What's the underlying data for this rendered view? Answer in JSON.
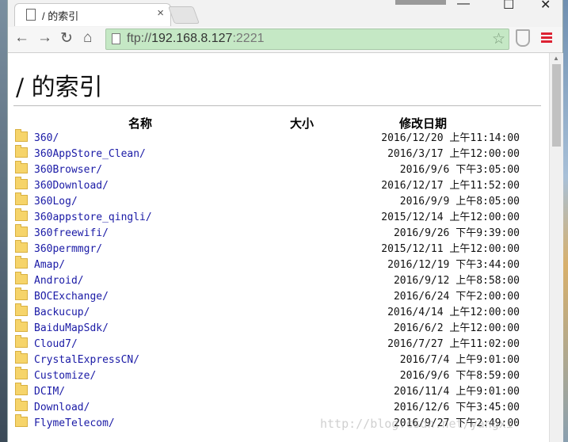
{
  "tab": {
    "title": "/ 的索引",
    "close": "×"
  },
  "nav": {
    "back": "←",
    "forward": "→",
    "reload": "↻",
    "home": "⌂"
  },
  "address": {
    "scheme": "ftp://",
    "host": "192.168.8.127",
    "port": ":2221"
  },
  "window_controls": {
    "minimize": "—",
    "maximize": "☐",
    "close": "✕"
  },
  "page": {
    "heading": "/ 的索引",
    "columns": {
      "name": "名称",
      "size": "大小",
      "date": "修改日期"
    },
    "rows": [
      {
        "name": "360/",
        "date": "2016/12/20 上午11:14:00"
      },
      {
        "name": "360AppStore_Clean/",
        "date": "2016/3/17 上午12:00:00"
      },
      {
        "name": "360Browser/",
        "date": "2016/9/6 下午3:05:00"
      },
      {
        "name": "360Download/",
        "date": "2016/12/17 上午11:52:00"
      },
      {
        "name": "360Log/",
        "date": "2016/9/9 上午8:05:00"
      },
      {
        "name": "360appstore_qingli/",
        "date": "2015/12/14 上午12:00:00"
      },
      {
        "name": "360freewifi/",
        "date": "2016/9/26 下午9:39:00"
      },
      {
        "name": "360permmgr/",
        "date": "2015/12/11 上午12:00:00"
      },
      {
        "name": "Amap/",
        "date": "2016/12/19 下午3:44:00"
      },
      {
        "name": "Android/",
        "date": "2016/9/12 上午8:58:00"
      },
      {
        "name": "BOCExchange/",
        "date": "2016/6/24 下午2:00:00"
      },
      {
        "name": "Backucup/",
        "date": "2016/4/14 上午12:00:00"
      },
      {
        "name": "BaiduMapSdk/",
        "date": "2016/6/2 上午12:00:00"
      },
      {
        "name": "Cloud7/",
        "date": "2016/7/27 上午11:02:00"
      },
      {
        "name": "CrystalExpressCN/",
        "date": "2016/7/4 上午9:01:00"
      },
      {
        "name": "Customize/",
        "date": "2016/9/6 下午8:59:00"
      },
      {
        "name": "DCIM/",
        "date": "2016/11/4 上午9:01:00"
      },
      {
        "name": "Download/",
        "date": "2016/12/6 下午3:45:00"
      },
      {
        "name": "FlymeTelecom/",
        "date": "2016/9/27 下午2:49:00"
      }
    ]
  },
  "watermark": "http://blog.csdn.net/yangxi"
}
